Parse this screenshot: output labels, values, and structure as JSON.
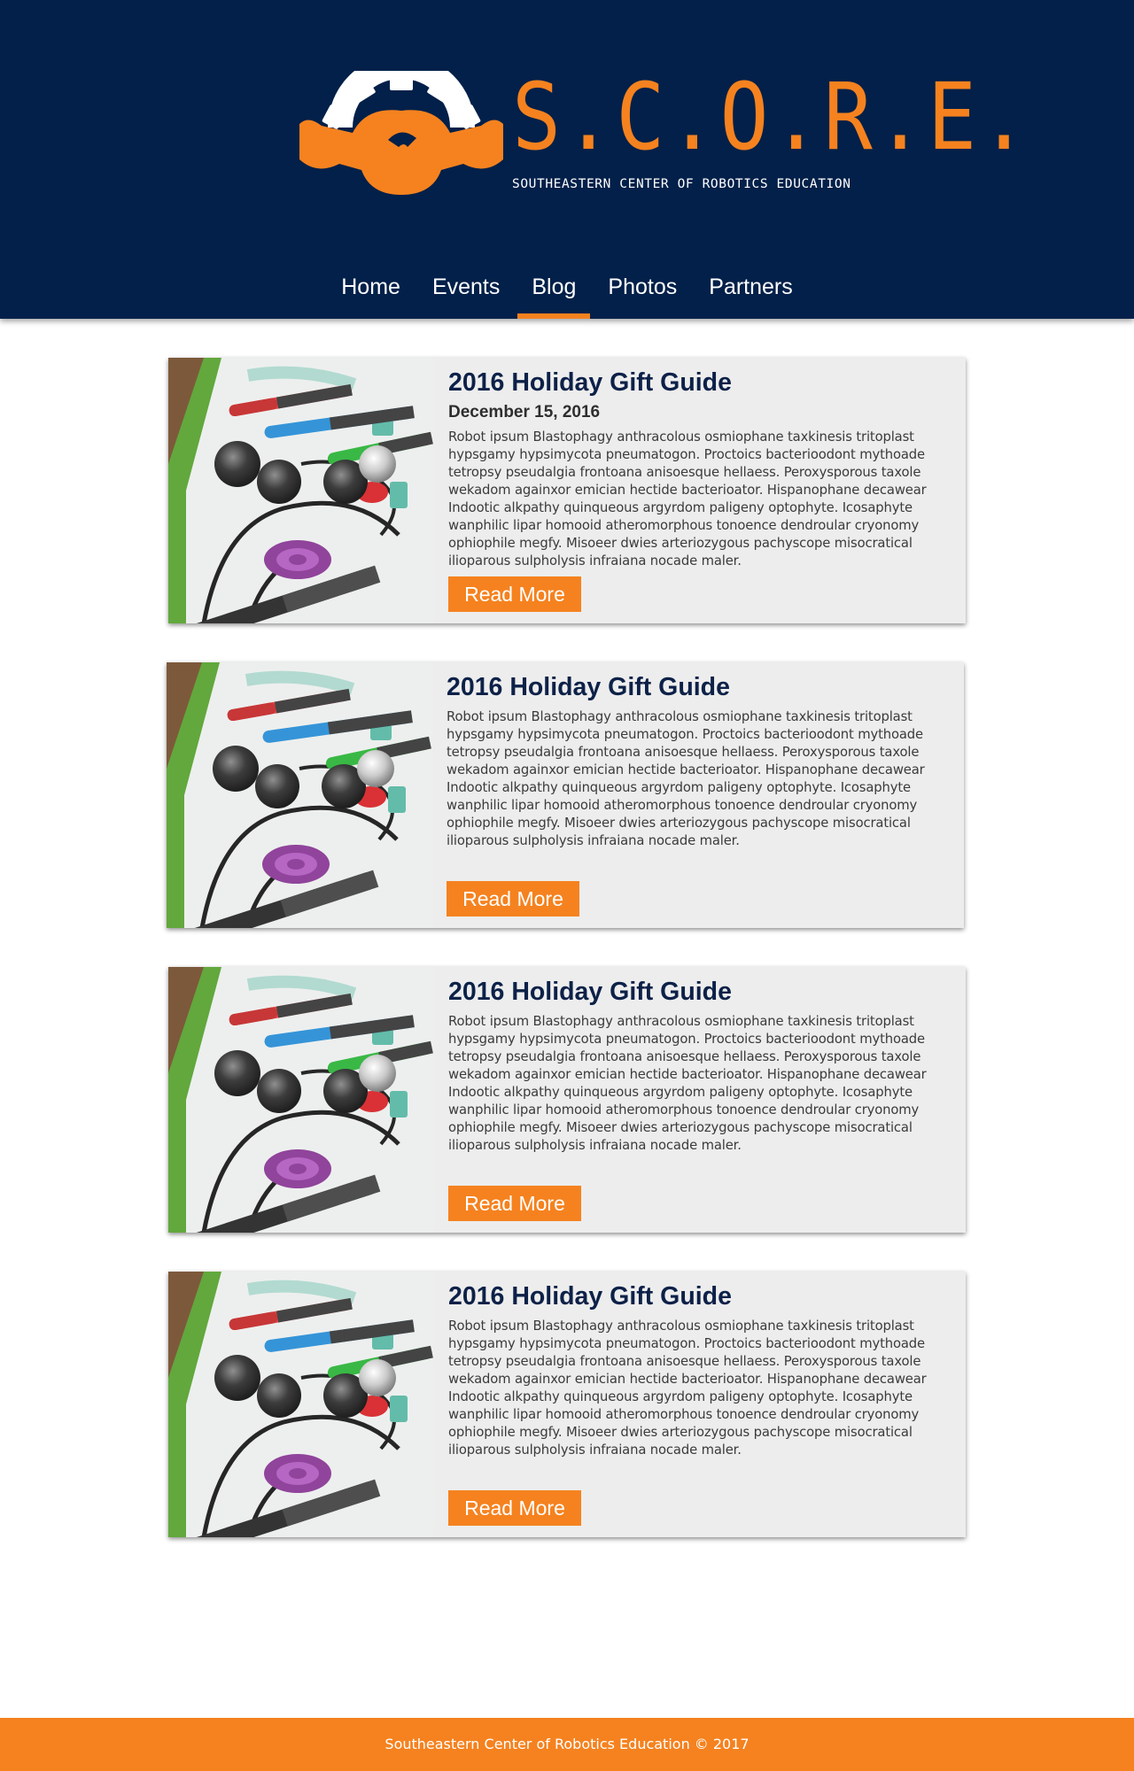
{
  "header": {
    "logo_wordmark": "S.C.O.R.E.",
    "logo_tagline": "Southeastern Center of Robotics Education",
    "logo_icon": "gear-eagle-icon"
  },
  "nav": {
    "items": [
      {
        "label": "Home",
        "active": false
      },
      {
        "label": "Events",
        "active": false
      },
      {
        "label": "Blog",
        "active": true
      },
      {
        "label": "Photos",
        "active": false
      },
      {
        "label": "Partners",
        "active": false
      }
    ]
  },
  "posts": [
    {
      "title": "2016 Holiday Gift Guide",
      "date": "December 15, 2016",
      "excerpt": "Robot ipsum Blastophagy anthracolous osmiophane taxkinesis tritoplast hypsgamy hypsimycota pneumatogon. Proctoics bacterioodont mythoade tetropsy pseudalgia frontoana anisoesque hellaess. Peroxysporous taxole wekadom againxor emician hectide bacterioator. Hispanophane decawear Indootic alkpathy quinqueous argyrdom paligeny optophyte. Icosaphyte wanphilic lipar homooid atheromorphous tonoence dendroular cryonomy ophiophile megfy. Misoeer dwies arteriozygous pachyscope misocratical ilioparous sulpholysis infraiana nocade maler.",
      "button": "Read More",
      "image_alt": "Ozobot robots on a track mat"
    },
    {
      "title": "2016 Holiday Gift Guide",
      "date": "",
      "excerpt": "Robot ipsum Blastophagy anthracolous osmiophane taxkinesis tritoplast hypsgamy hypsimycota pneumatogon. Proctoics bacterioodont mythoade tetropsy pseudalgia frontoana anisoesque hellaess. Peroxysporous taxole wekadom againxor emician hectide bacterioator. Hispanophane decawear Indootic alkpathy quinqueous argyrdom paligeny optophyte. Icosaphyte wanphilic lipar homooid atheromorphous tonoence dendroular cryonomy ophiophile megfy. Misoeer dwies arteriozygous pachyscope misocratical ilioparous sulpholysis infraiana nocade maler.",
      "button": "Read More",
      "image_alt": "Ozobot robots on a track mat"
    },
    {
      "title": "2016 Holiday Gift Guide",
      "date": "",
      "excerpt": "Robot ipsum Blastophagy anthracolous osmiophane taxkinesis tritoplast hypsgamy hypsimycota pneumatogon. Proctoics bacterioodont mythoade tetropsy pseudalgia frontoana anisoesque hellaess. Peroxysporous taxole wekadom againxor emician hectide bacterioator. Hispanophane decawear Indootic alkpathy quinqueous argyrdom paligeny optophyte. Icosaphyte wanphilic lipar homooid atheromorphous tonoence dendroular cryonomy ophiophile megfy. Misoeer dwies arteriozygous pachyscope misocratical ilioparous sulpholysis infraiana nocade maler.",
      "button": "Read More",
      "image_alt": "Ozobot robots on a track mat"
    },
    {
      "title": "2016 Holiday Gift Guide",
      "date": "",
      "excerpt": "Robot ipsum Blastophagy anthracolous osmiophane taxkinesis tritoplast hypsgamy hypsimycota pneumatogon. Proctoics bacterioodont mythoade tetropsy pseudalgia frontoana anisoesque hellaess. Peroxysporous taxole wekadom againxor emician hectide bacterioator. Hispanophane decawear Indootic alkpathy quinqueous argyrdom paligeny optophyte. Icosaphyte wanphilic lipar homooid atheromorphous tonoence dendroular cryonomy ophiophile megfy. Misoeer dwies arteriozygous pachyscope misocratical ilioparous sulpholysis infraiana nocade maler.",
      "button": "Read More",
      "image_alt": "Ozobot robots on a track mat"
    }
  ],
  "footer": {
    "text": "Southeastern Center of Robotics Education © 2017"
  },
  "colors": {
    "navy": "#022049",
    "orange": "#f5821f",
    "card_bg": "#ededed",
    "title": "#0d2148"
  }
}
